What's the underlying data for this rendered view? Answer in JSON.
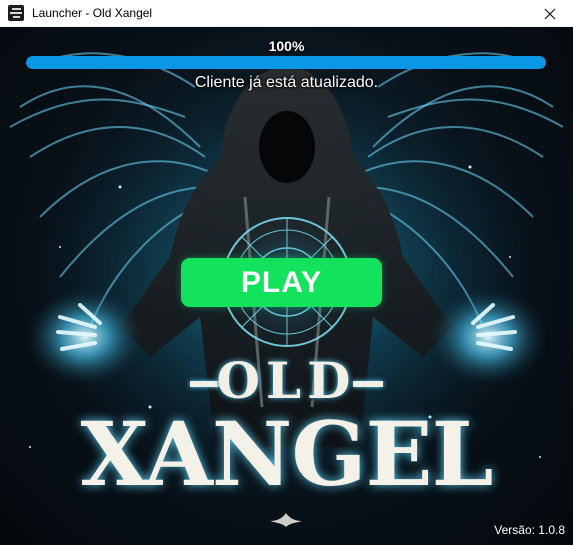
{
  "window": {
    "title": "Launcher - Old Xangel",
    "app_icon": "old-xangel-app-icon",
    "close_icon": "close-icon"
  },
  "progress": {
    "percent_label": "100%",
    "value_percent": 100,
    "status": "Cliente já está atualizado.",
    "fill_color": "#0a97e6"
  },
  "play_button": {
    "label": "PLAY",
    "color": "#12e25c"
  },
  "logo": {
    "line1": "OLD",
    "line2": "XANGEL"
  },
  "footer": {
    "version": "Versão: 1.0.8"
  },
  "colors": {
    "glow": "#5fd8ff",
    "background_dark": "#04080c"
  }
}
